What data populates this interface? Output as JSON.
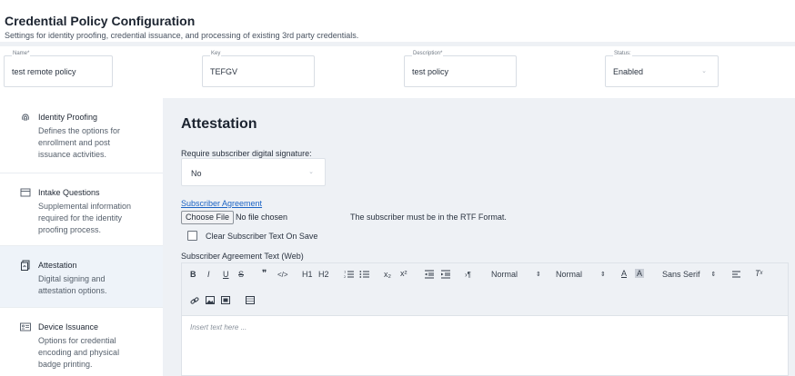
{
  "header": {
    "title": "Credential Policy Configuration",
    "subtitle": "Settings for identity proofing, credential issuance, and processing of existing 3rd party credentials."
  },
  "fields": {
    "name": {
      "label": "Name*",
      "value": "test remote policy"
    },
    "key": {
      "label": "Key",
      "value": "TEFGV"
    },
    "description": {
      "label": "Description*",
      "value": "test policy"
    },
    "status": {
      "label": "Status:",
      "value": "Enabled"
    }
  },
  "sidebar": {
    "items": [
      {
        "title": "Identity Proofing",
        "desc": "Defines the options for enrollment and post issuance activities.",
        "icon": "fingerprint-icon"
      },
      {
        "title": "Intake Questions",
        "desc": "Supplemental information required for the identity proofing process.",
        "icon": "inbox-icon"
      },
      {
        "title": "Attestation",
        "desc": "Digital signing and attestation options.",
        "icon": "document-sign-icon",
        "active": true
      },
      {
        "title": "Device Issuance",
        "desc": "Options for credential encoding and physical badge printing.",
        "icon": "id-card-icon"
      }
    ]
  },
  "main": {
    "heading": "Attestation",
    "signature_label": "Require subscriber digital signature:",
    "signature_value": "No",
    "agreement_link": "Subscriber Agreement",
    "choose_file": "Choose File",
    "no_file": "No file chosen",
    "file_note": "The subscriber must be in the RTF Format.",
    "clear_label": "Clear Subscriber Text On Save",
    "editor_label": "Subscriber Agreement Text (Web)",
    "editor_placeholder": "Insert text here ...",
    "toolbar": {
      "header_size": "Normal",
      "font_size": "Normal",
      "font_family": "Sans Serif",
      "h1": "H1",
      "h2": "H2",
      "bold": "B",
      "italic": "I",
      "underline": "U",
      "strike": "S",
      "quote": "❞",
      "code": "</>",
      "sub": "x₂",
      "sup": "x²"
    }
  },
  "colors": {
    "accent_link": "#1b63c4",
    "main_bg": "#eef1f5",
    "active_nav_bg": "#eef3f9"
  }
}
